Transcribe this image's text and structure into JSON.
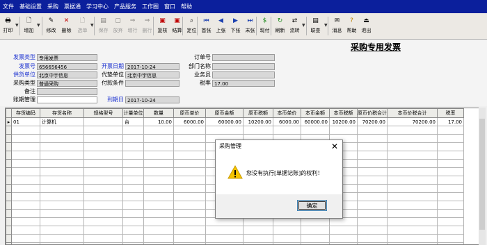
{
  "menubar": {
    "items": [
      "文件",
      "基础设置",
      "采购",
      "票据通",
      "学习中心",
      "产品服务",
      "工作圈",
      "窗口",
      "帮助"
    ]
  },
  "toolbar": {
    "buttons": [
      {
        "label": "打印",
        "icon": "printer-icon"
      },
      {
        "label": "增加",
        "icon": "add-document-icon"
      },
      {
        "label": "修改",
        "icon": "edit-icon"
      },
      {
        "label": "删除",
        "icon": "delete-icon"
      },
      {
        "label": "选单",
        "icon": "select-icon"
      },
      {
        "label": "保存",
        "icon": "save-icon"
      },
      {
        "label": "放弃",
        "icon": "discard-icon"
      },
      {
        "label": "增行",
        "icon": "add-row-icon"
      },
      {
        "label": "删行",
        "icon": "delete-row-icon"
      },
      {
        "label": "复核",
        "icon": "review-icon"
      },
      {
        "label": "结算",
        "icon": "settle-icon"
      },
      {
        "label": "定位",
        "icon": "locate-icon"
      },
      {
        "label": "首张",
        "icon": "first-record-icon"
      },
      {
        "label": "上张",
        "icon": "previous-record-icon"
      },
      {
        "label": "下张",
        "icon": "next-record-icon"
      },
      {
        "label": "末张",
        "icon": "last-record-icon"
      },
      {
        "label": "现付",
        "icon": "pay-now-icon"
      },
      {
        "label": "刷新",
        "icon": "refresh-icon"
      },
      {
        "label": "流转",
        "icon": "flow-icon"
      },
      {
        "label": "联查",
        "icon": "linked-query-icon"
      },
      {
        "label": "消息",
        "icon": "message-icon"
      },
      {
        "label": "帮助",
        "icon": "help-icon"
      },
      {
        "label": "退出",
        "icon": "exit-icon"
      }
    ]
  },
  "form": {
    "title": "采购专用发票",
    "invoice_type": {
      "label": "发票类型",
      "value": "专用发票"
    },
    "invoice_no": {
      "label": "发票号",
      "value": "656656456"
    },
    "supplier": {
      "label": "供货单位",
      "value": "北京中宇信息"
    },
    "purchase_type": {
      "label": "采购类型",
      "value": "普通采购"
    },
    "remark": {
      "label": "备注",
      "value": ""
    },
    "account_mgmt": {
      "label": "账期管理",
      "value": ""
    },
    "invoice_date": {
      "label": "开票日期",
      "value": "2017-10-24"
    },
    "agent_unit": {
      "label": "代垫单位",
      "value": "北京中宇信息"
    },
    "payment_terms": {
      "label": "付款条件",
      "value": ""
    },
    "due_date": {
      "label": "到期日",
      "value": "2017-10-24"
    },
    "order_no": {
      "label": "订单号",
      "value": ""
    },
    "department": {
      "label": "部门名称",
      "value": ""
    },
    "salesperson": {
      "label": "业务员",
      "value": ""
    },
    "tax_rate": {
      "label": "税率",
      "value": "17.00"
    }
  },
  "grid": {
    "columns": [
      "存货编码",
      "存货名称",
      "规格型号",
      "计量单位",
      "数量",
      "原币单价",
      "原币金额",
      "原币税额",
      "本币单价",
      "本币金额",
      "本币税额",
      "原币价税合计",
      "本币价税合计",
      "税率"
    ],
    "rows": [
      {
        "marker": "▸",
        "cells": [
          "01",
          "计算机",
          "",
          "台",
          "10.00",
          "6000.00",
          "60000.00",
          "10200.00",
          "6000.00",
          "60000.00",
          "10200.00",
          "70200.00",
          "70200.00",
          "17.00"
        ]
      }
    ]
  },
  "dialog": {
    "title": "采购管理",
    "message": "您没有执行[单据记账]的权利！",
    "ok_label": "确定",
    "close_glyph": "✕"
  },
  "colors": {
    "menubar": "#0b1f9c",
    "blue_label": "#1a30d0",
    "field_gray": "#d8d8d8",
    "warning_yellow": "#f5c400"
  }
}
